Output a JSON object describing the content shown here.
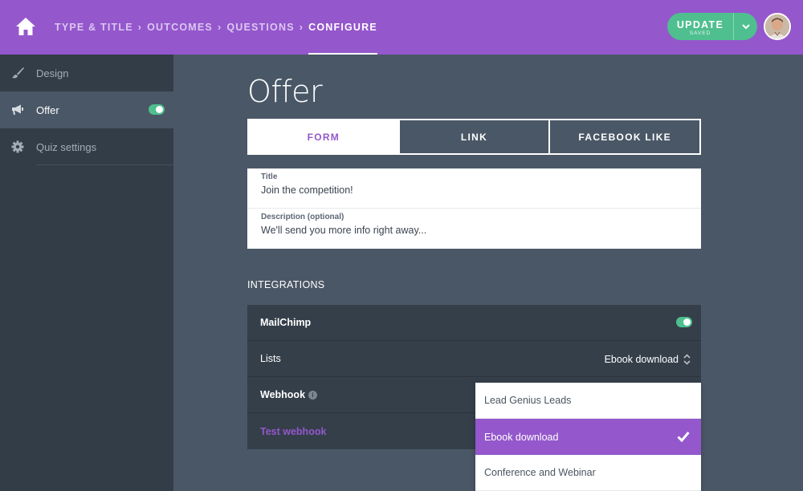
{
  "header": {
    "breadcrumbs": [
      "TYPE & TITLE",
      "OUTCOMES",
      "QUESTIONS",
      "CONFIGURE"
    ],
    "separator": "›",
    "update_label": "UPDATE",
    "update_status": "SAVED",
    "accent_color": "#9457cc",
    "success_color": "#4fbf8f",
    "icons": [
      "home-icon",
      "chevron-down-icon",
      "user-avatar"
    ]
  },
  "sidebar": {
    "items": [
      {
        "label": "Design",
        "icon": "paintbrush-icon",
        "active": false
      },
      {
        "label": "Offer",
        "icon": "megaphone-icon",
        "active": true,
        "toggle_on": true
      },
      {
        "label": "Quiz settings",
        "icon": "gear-icon",
        "active": false
      }
    ]
  },
  "main": {
    "title": "Offer",
    "tabs": [
      {
        "label": "FORM",
        "active": true
      },
      {
        "label": "LINK",
        "active": false
      },
      {
        "label": "FACEBOOK LIKE",
        "active": false
      }
    ],
    "form": {
      "title_label": "Title",
      "title_value": "Join the competition!",
      "description_label": "Description (optional)",
      "description_value": "We'll send you more info right away..."
    },
    "integrations": {
      "heading": "INTEGRATIONS",
      "mailchimp_label": "MailChimp",
      "mailchimp_enabled": true,
      "lists_label": "Lists",
      "lists_value": "Ebook download",
      "webhook_label": "Webhook",
      "webhook_info": "i",
      "test_webhook_label": "Test webhook"
    },
    "dropdown": {
      "options": [
        "Lead Genius Leads",
        "Ebook download",
        "Conference and Webinar"
      ],
      "selected": "Ebook download"
    }
  }
}
